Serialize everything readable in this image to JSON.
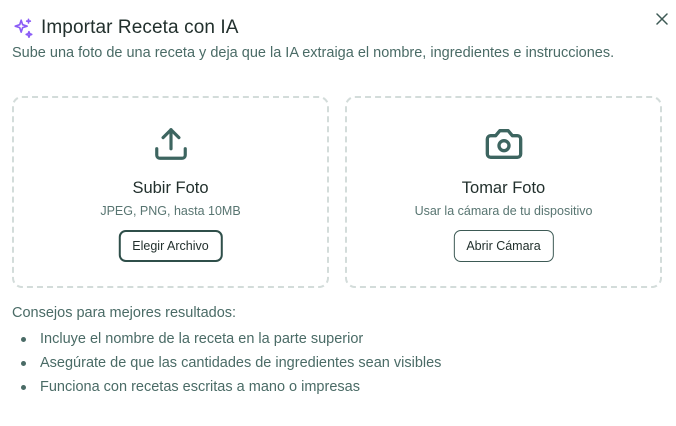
{
  "dialog": {
    "title": "Importar Receta con IA",
    "subtitle": "Sube una foto de una receta y deja que la IA extraiga el nombre, ingredientes e instrucciones.",
    "title_icon": "sparkles-icon",
    "close_icon": "close-icon"
  },
  "upload_card": {
    "icon": "upload-icon",
    "title": "Subir Foto",
    "description": "JPEG, PNG, hasta 10MB",
    "button_label": "Elegir Archivo"
  },
  "camera_card": {
    "icon": "camera-icon",
    "title": "Tomar Foto",
    "description": "Usar la cámara de tu dispositivo",
    "button_label": "Abrir Cámara"
  },
  "tips": {
    "heading": "Consejos para mejores resultados:",
    "items": [
      "Incluye el nombre de la receta en la parte superior",
      "Asegúrate de que las cantidades de ingredientes sean visibles",
      "Funciona con recetas escritas a mano o impresas"
    ]
  },
  "colors": {
    "accent": "#8b5cf6",
    "icon": "#3d6560",
    "text": "#22302d",
    "muted": "#4a6b66",
    "border_dashed": "#d3dcda"
  }
}
